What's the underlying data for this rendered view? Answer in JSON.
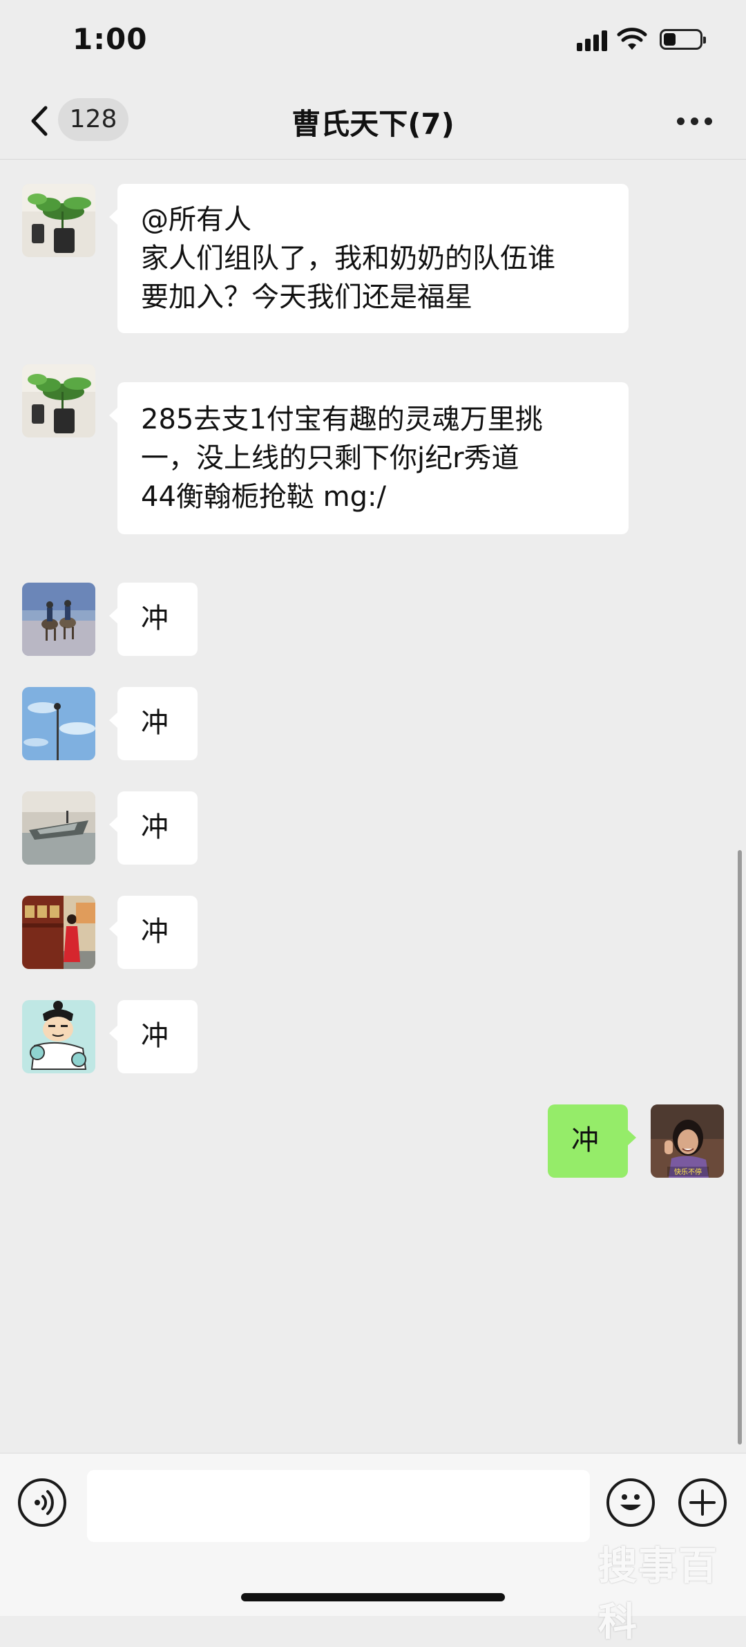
{
  "status_bar": {
    "time": "1:00"
  },
  "nav": {
    "unread_count": "128",
    "title": "曹氏天下(7)"
  },
  "messages": [
    {
      "side": "left",
      "avatar": "plant-avatar",
      "lines": [
        "@所有人",
        "家人们组队了，我和奶奶的队伍谁",
        "要加入？今天我们还是福星"
      ]
    },
    {
      "side": "left",
      "avatar": "plant-avatar",
      "lines": [
        "285去支1付宝有趣的灵魂万里挑",
        "一，没上线的只剩下你j纪r秀道",
        "44衡翰栀抢鞑 mg:/"
      ]
    },
    {
      "side": "left",
      "avatar": "horse-riders-avatar",
      "lines": [
        "冲"
      ]
    },
    {
      "side": "left",
      "avatar": "sky-lamp-avatar",
      "lines": [
        "冲"
      ]
    },
    {
      "side": "left",
      "avatar": "boat-avatar",
      "lines": [
        "冲"
      ]
    },
    {
      "side": "left",
      "avatar": "woman-train-avatar",
      "lines": [
        "冲"
      ]
    },
    {
      "side": "left",
      "avatar": "cartoon-avatar",
      "lines": [
        "冲"
      ]
    },
    {
      "side": "right",
      "avatar": "self-avatar",
      "lines": [
        "冲"
      ]
    }
  ],
  "self_avatar_caption": "快乐不停",
  "input": {
    "placeholder": ""
  },
  "watermark": "搜事百科",
  "colors": {
    "background": "#ededed",
    "bubble_self": "#95ec69",
    "bubble_other": "#ffffff"
  }
}
